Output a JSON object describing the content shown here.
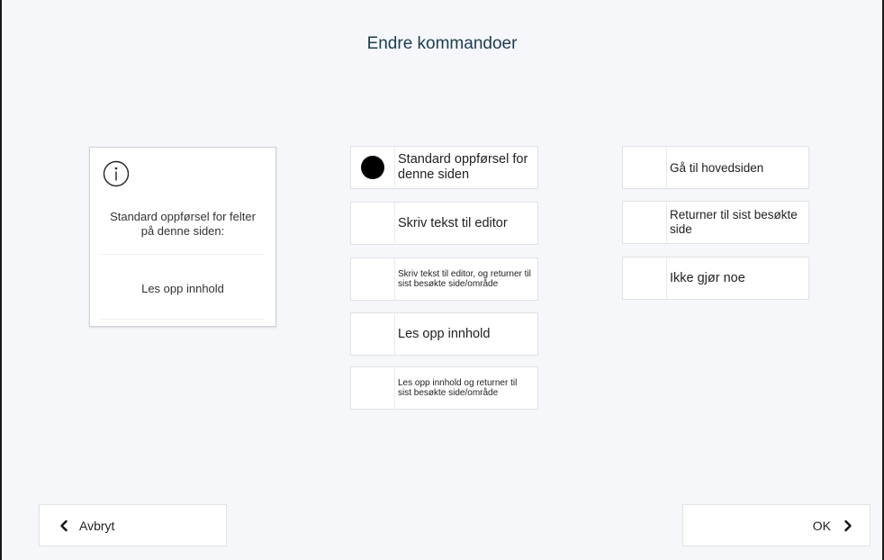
{
  "dialog": {
    "title": "Endre kommandoer"
  },
  "info": {
    "icon": "info-icon",
    "description": "Standard oppførsel for felter på denne siden:",
    "value": "Les opp innhold"
  },
  "options": {
    "col1": [
      {
        "label": "Standard oppførsel for denne siden",
        "selected": true
      },
      {
        "label": "Skriv tekst til editor",
        "selected": false
      },
      {
        "label": "Skriv tekst til editor, og returner til sist besøkte side/område",
        "selected": false
      },
      {
        "label": "Les opp innhold",
        "selected": false
      },
      {
        "label": "Les opp innhold og returner til sist besøkte side/område",
        "selected": false
      }
    ],
    "col2": [
      {
        "label": "Gå til hovedsiden",
        "selected": false
      },
      {
        "label": "Returner til sist besøkte side",
        "selected": false
      },
      {
        "label": "Ikke gjør noe",
        "selected": false
      }
    ]
  },
  "footer": {
    "cancel_label": "Avbryt",
    "cancel_icon": "chevron-left-icon",
    "ok_label": "OK",
    "ok_icon": "chevron-right-icon"
  }
}
